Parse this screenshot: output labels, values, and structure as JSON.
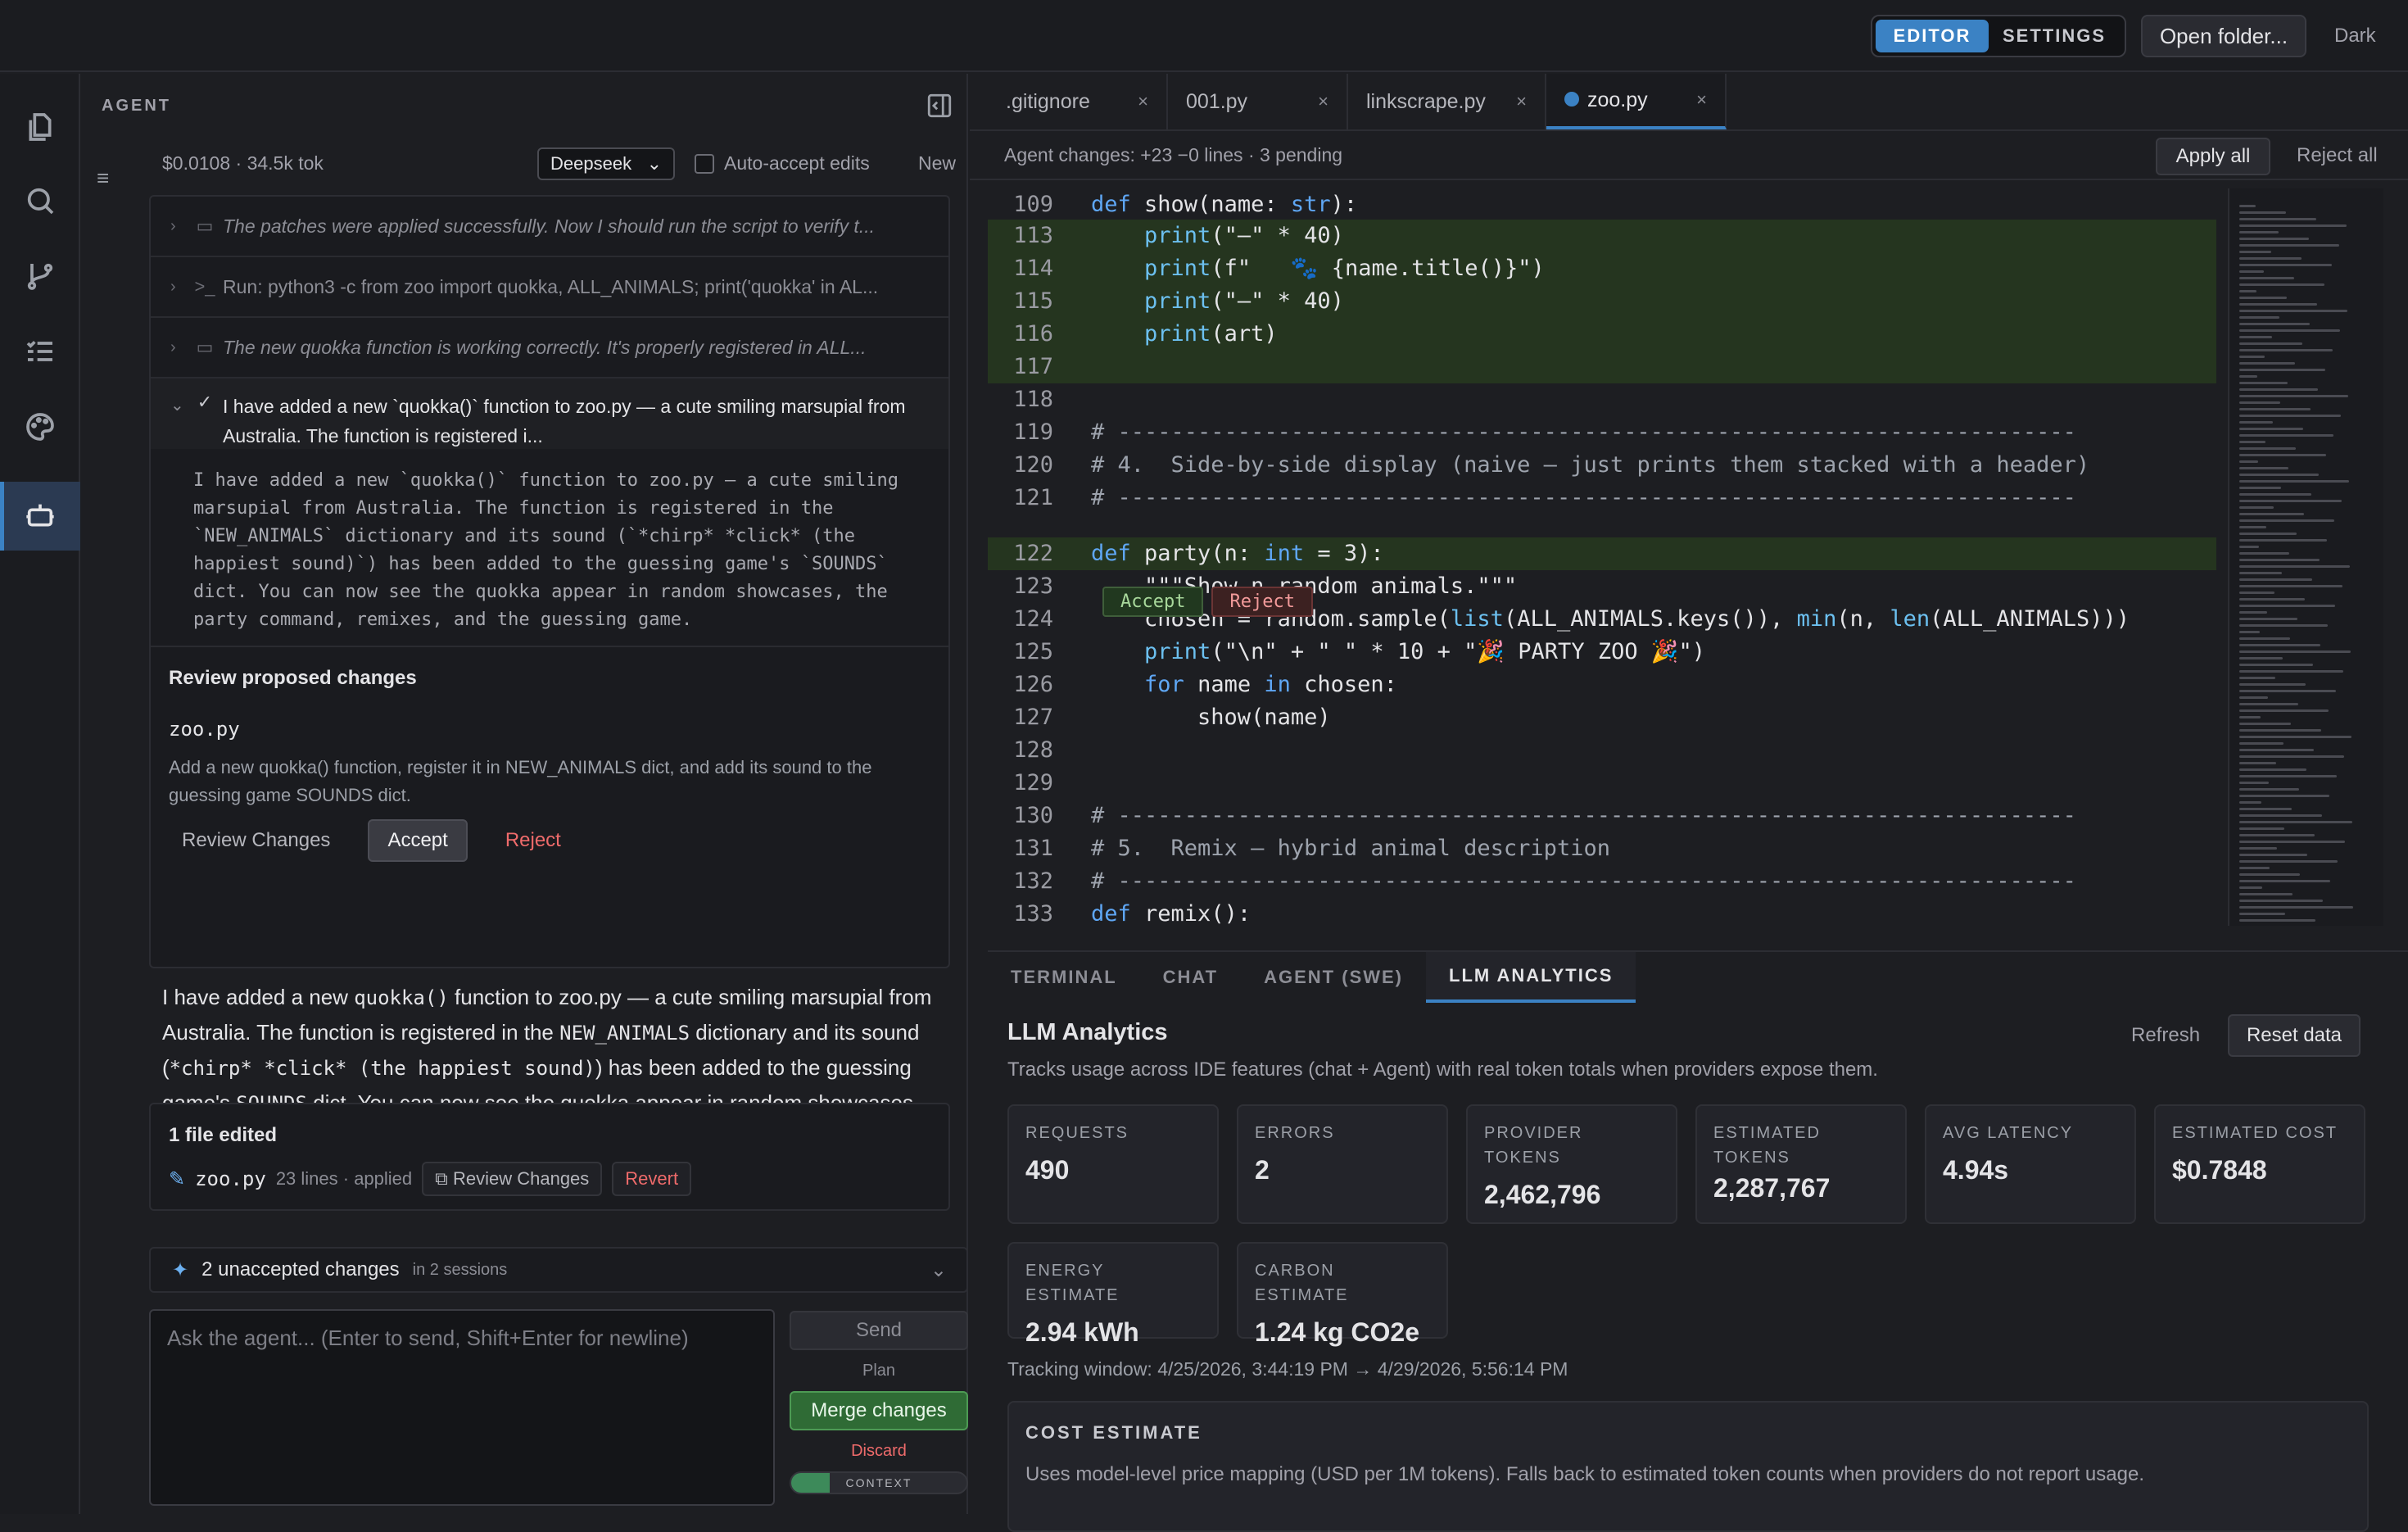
{
  "topbar": {
    "editor_label": "EDITOR",
    "settings_label": "SETTINGS",
    "open_folder_label": "Open folder...",
    "theme_label": "Dark"
  },
  "activity": {
    "items": [
      "files-icon",
      "search-icon",
      "source-control-icon",
      "checklist-icon",
      "palette-icon",
      "agent-robot-icon"
    ]
  },
  "agent": {
    "title": "AGENT",
    "cost_line": "$0.0108 · 34.5k tok",
    "model": "Deepseek",
    "auto_accept_label": "Auto-accept edits",
    "new_label": "New",
    "steps": [
      "The patches were applied successfully. Now I should run the script to verify t...",
      "Run: python3 -c from zoo import quokka, ALL_ANIMALS; print('quokka' in AL...",
      "The new quokka function is working correctly. It's properly registered in ALL..."
    ],
    "final_step": "I have added a new `quokka()` function to zoo.py — a cute smiling marsupial from Australia. The function is registered i...",
    "final_body": "I have added a new `quokka()` function to zoo.py – a cute smiling\nmarsupial from Australia. The function is registered in the\n`NEW_ANIMALS` dictionary and its sound (`*chirp* *click* (the\nhappiest sound)`) has been added to the guessing game's `SOUNDS`\ndict. You can now see the quokka appear in random showcases, the\nparty command, remixes, and the guessing game.",
    "review": {
      "title": "Review proposed changes",
      "file": "zoo.py",
      "desc": "Add a new quokka() function, register it in NEW_ANIMALS dict, and add its sound to the guessing game SOUNDS dict.",
      "review_label": "Review Changes",
      "accept_label": "Accept",
      "reject_label": "Reject"
    },
    "summary": {
      "p1": "I have added a new ",
      "c1": "quokka()",
      "p2": " function to zoo.py — a cute smiling marsupial from Australia. The function is registered in the ",
      "c2": "NEW_ANIMALS",
      "p3": " dictionary and its sound (",
      "c3": "*chirp* *click* (the happiest sound)",
      "p4": ") has been added to the guessing game's ",
      "c4": "SOUNDS",
      "p5": " dict. You can now see the quokka appear in random showcases, the party command, remixes, and the guessing game."
    },
    "edited": {
      "title": "1 file edited",
      "file": "zoo.py",
      "meta": "23 lines · applied",
      "review_label": "Review Changes",
      "revert_label": "Revert"
    },
    "uncommitted": {
      "label": "2 unaccepted changes",
      "sub": "in 2 sessions"
    },
    "ask_placeholder": "Ask the agent... (Enter to send, Shift+Enter for newline)",
    "send_label": "Send",
    "plan_label": "Plan",
    "merge_label": "Merge changes",
    "discard_label": "Discard",
    "context_label": "CONTEXT",
    "context_fraction": 0.22
  },
  "editor": {
    "tabs": [
      ".gitignore",
      "001.py",
      "linkscrape.py",
      "zoo.py"
    ],
    "agent_changes": "Agent changes: +23 −0 lines · 3 pending",
    "apply_all": "Apply all",
    "reject_all": "Reject all",
    "accept_inline": "Accept",
    "reject_inline": "Reject"
  },
  "code_lines": [
    {
      "n": "109",
      "t": "def show(name: str):"
    },
    {
      "n": "113",
      "t": "    print(\"—\" * 40)"
    },
    {
      "n": "114",
      "t": "    print(f\"   🐾 {name.title()}\")"
    },
    {
      "n": "115",
      "t": "    print(\"—\" * 40)"
    },
    {
      "n": "116",
      "t": "    print(art)"
    },
    {
      "n": "117",
      "t": ""
    },
    {
      "n": "118",
      "t": ""
    },
    {
      "n": "119",
      "t": "# ------------------------------------------------------------------------"
    },
    {
      "n": "120",
      "t": "# 4.  Side-by-side display (naive — just prints them stacked with a header)"
    },
    {
      "n": "121",
      "t": "# ------------------------------------------------------------------------"
    },
    {
      "n": "122",
      "t": "def party(n: int = 3):"
    },
    {
      "n": "123",
      "t": "    \"\"\"Show n random animals.\"\"\""
    },
    {
      "n": "124",
      "t": "    chosen = random.sample(list(ALL_ANIMALS.keys()), min(n, len(ALL_ANIMALS)))"
    },
    {
      "n": "125",
      "t": "    print(\"\\n\" + \" \" * 10 + \"🎉 PARTY ZOO 🎉\")"
    },
    {
      "n": "126",
      "t": "    for name in chosen:"
    },
    {
      "n": "127",
      "t": "        show(name)"
    },
    {
      "n": "128",
      "t": ""
    },
    {
      "n": "129",
      "t": ""
    },
    {
      "n": "130",
      "t": "# ------------------------------------------------------------------------"
    },
    {
      "n": "131",
      "t": "# 5.  Remix — hybrid animal description"
    },
    {
      "n": "132",
      "t": "# ------------------------------------------------------------------------"
    },
    {
      "n": "133",
      "t": "def remix():"
    }
  ],
  "panel": {
    "tabs": [
      "TERMINAL",
      "CHAT",
      "AGENT (SWE)",
      "LLM ANALYTICS"
    ],
    "title": "LLM Analytics",
    "subtitle": "Tracks usage across IDE features (chat + Agent) with real token totals when providers expose them.",
    "refresh_label": "Refresh",
    "reset_label": "Reset data",
    "cards": [
      {
        "label": "REQUESTS",
        "value": "490"
      },
      {
        "label": "ERRORS",
        "value": "2"
      },
      {
        "label": "PROVIDER TOKENS",
        "value": "2,462,796"
      },
      {
        "label": "ESTIMATED TOKENS",
        "value": "2,287,767"
      },
      {
        "label": "AVG LATENCY",
        "value": "4.94s"
      },
      {
        "label": "ESTIMATED COST",
        "value": "$0.7848"
      },
      {
        "label": "ENERGY ESTIMATE",
        "value": "2.94 kWh"
      },
      {
        "label": "CARBON ESTIMATE",
        "value": "1.24 kg CO2e"
      }
    ],
    "tracking": "Tracking window: 4/25/2026, 3:44:19 PM → 4/29/2026, 5:56:14 PM",
    "cost_title": "COST ESTIMATE",
    "cost_desc": "Uses model-level price mapping (USD per 1M tokens). Falls back to estimated token counts when providers do not report usage."
  }
}
